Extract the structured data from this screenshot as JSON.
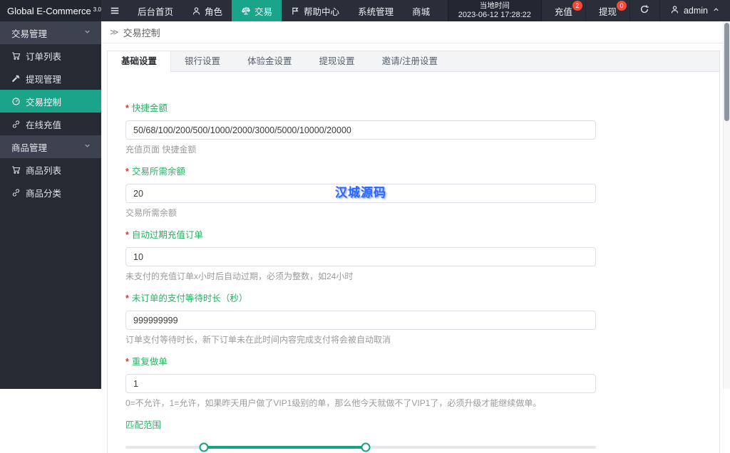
{
  "app": {
    "title": "Global E-Commerce",
    "version": "3.0"
  },
  "topnav": {
    "menu": [
      {
        "label": "后台首页",
        "icon": null
      },
      {
        "label": "角色",
        "icon": "person"
      },
      {
        "label": "交易",
        "icon": "scale",
        "active": true
      },
      {
        "label": "帮助中心",
        "icon": "flag"
      },
      {
        "label": "系统管理",
        "icon": null
      },
      {
        "label": "商城",
        "icon": null
      }
    ],
    "local_time_label": "当地时间",
    "local_time_value": "2023-06-12 17:28:22",
    "recharge_label": "充值",
    "recharge_badge": "2",
    "withdraw_label": "提现",
    "withdraw_badge": "0",
    "username": "admin"
  },
  "sidebar": {
    "groups": [
      {
        "label": "交易管理",
        "items": [
          {
            "label": "订单列表",
            "icon": "cart"
          },
          {
            "label": "提现管理",
            "icon": "gavel"
          },
          {
            "label": "交易控制",
            "icon": "gauge",
            "active": true
          },
          {
            "label": "在线充值",
            "icon": "link"
          }
        ]
      },
      {
        "label": "商品管理",
        "items": [
          {
            "label": "商品列表",
            "icon": "cart"
          },
          {
            "label": "商品分类",
            "icon": "link"
          }
        ]
      }
    ]
  },
  "main": {
    "breadcrumb_separator": "≫",
    "breadcrumb": "交易控制",
    "tabs": [
      "基础设置",
      "银行设置",
      "体验金设置",
      "提现设置",
      "邀请/注册设置"
    ],
    "active_tab": "基础设置"
  },
  "form": {
    "required_mark": "*",
    "fields": [
      {
        "label": "快捷金额",
        "required": true,
        "value": "50/68/100/200/500/1000/2000/3000/5000/10000/20000",
        "hint": "充值页面 快捷金额"
      },
      {
        "label": "交易所需余额",
        "required": true,
        "value": "20",
        "hint": "交易所需余额"
      },
      {
        "label": "自动过期充值订单",
        "required": true,
        "value": "10",
        "hint": "未支付的充值订单x小时后自动过期，必须为整数，如24小时"
      },
      {
        "label": "未订单的支付等待时长（秒）",
        "required": true,
        "value": "999999999",
        "hint": "订单支付等待时长，新下订单未在此时间内容完成支付将会被自动取消"
      },
      {
        "label": "重复做单",
        "required": true,
        "value": "1",
        "hint": "0=不允许，1=允许，如果昨天用户做了VIP1级别的单，那么他今天就做不了VIP1了，必须升级才能继续做单。"
      }
    ],
    "slider": {
      "label": "匹配范围",
      "low_pct": 16.7,
      "high_pct": 51
    }
  },
  "watermark": "汉城源码",
  "colors": {
    "accent_green": "#1aa489",
    "label_green": "#28b264",
    "badge_red": "#ff4636",
    "watermark_blue": "#2b66ff",
    "navbar_dark": "#2a2e38",
    "sidebar_dark": "#262a33"
  }
}
